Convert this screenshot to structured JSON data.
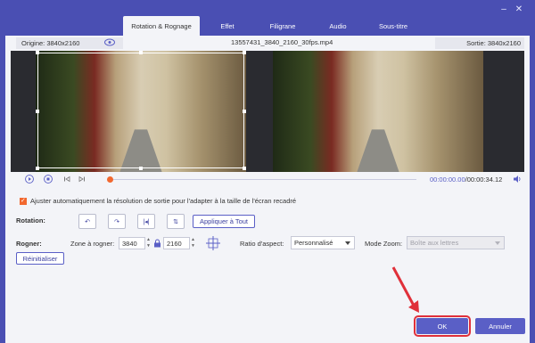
{
  "window": {
    "minimize_icon": "minimize-icon",
    "close_icon": "close-icon"
  },
  "tabs": [
    {
      "label": "Rotation & Rognage",
      "active": true
    },
    {
      "label": "Effet"
    },
    {
      "label": "Filigrane"
    },
    {
      "label": "Audio"
    },
    {
      "label": "Sous-titre"
    }
  ],
  "infobar": {
    "origin": "Origine: 3840x2160",
    "filename": "13557431_3840_2160_30fps.mp4",
    "output": "Sortie: 3840x2160"
  },
  "player": {
    "current": "00:00:00.00",
    "total": "/00:00:34.12"
  },
  "options": {
    "auto_adjust": "Ajuster automatiquement la résolution de sortie pour l'adapter à la taille de l'écran recadré"
  },
  "rotation": {
    "label": "Rotation:",
    "apply_all": "Appliquer à Tout"
  },
  "crop": {
    "label": "Rogner:",
    "zone_label": "Zone à rogner:",
    "width": "3840",
    "height": "2160",
    "ratio_label": "Ratio d'aspect:",
    "ratio_value": "Personnalisé",
    "zoom_label": "Mode Zoom:",
    "zoom_value": "Boîte aux lettres",
    "reset": "Réinitialiser"
  },
  "buttons": {
    "ok": "OK",
    "cancel": "Annuler"
  },
  "colors": {
    "accent": "#5a5fc6",
    "orange": "#f2682f",
    "red_highlight": "#e0303a",
    "titlebar": "#4a4fb3"
  }
}
